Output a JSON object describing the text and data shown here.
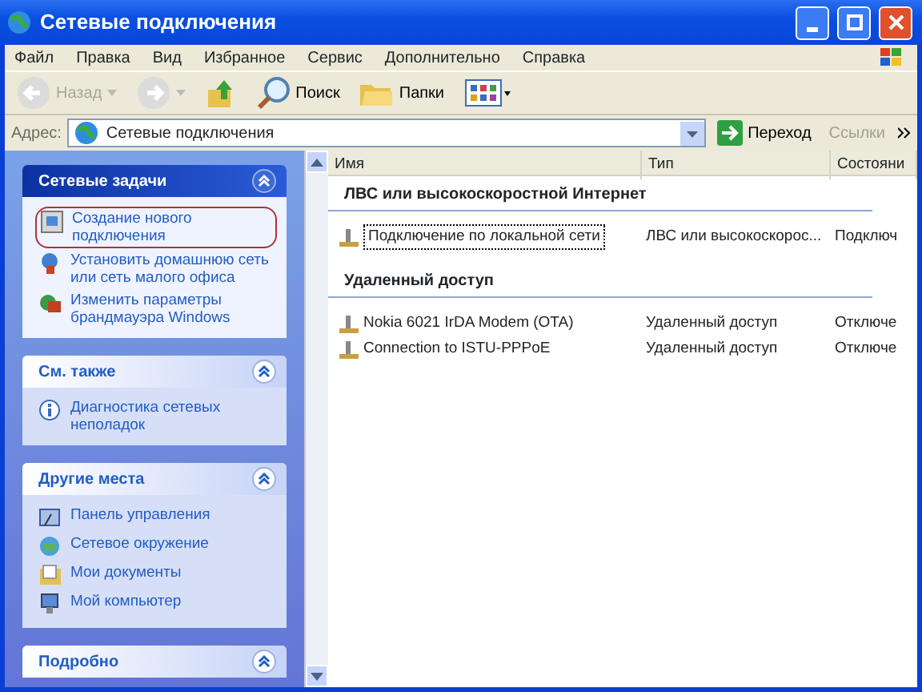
{
  "window": {
    "title": "Сетевые подключения"
  },
  "menu": [
    "Файл",
    "Правка",
    "Вид",
    "Избранное",
    "Сервис",
    "Дополнительно",
    "Справка"
  ],
  "toolbar": [
    {
      "kind": "back",
      "label": "Назад",
      "disabled": true
    },
    {
      "kind": "forward",
      "disabled": true
    },
    {
      "kind": "up",
      "disabled": false
    },
    {
      "kind": "search",
      "label": "Поиск",
      "disabled": false
    },
    {
      "kind": "folders",
      "label": "Папки",
      "disabled": false
    },
    {
      "kind": "views",
      "disabled": false
    }
  ],
  "address_bar": {
    "label": "Адрес:",
    "value": "Сетевые подключения",
    "go_button": "Переход",
    "links": "Ссылки"
  },
  "sidebar": {
    "panels": [
      {
        "title": "Сетевые задачи",
        "items": [
          {
            "kind": "wizard",
            "label": "Создание нового подключения",
            "highlighted": true
          },
          {
            "kind": "home",
            "label": "Установить домашнюю сеть или сеть малого офиса",
            "highlighted": false
          },
          {
            "kind": "firewall",
            "label": "Изменить параметры брандмауэра Windows",
            "highlighted": false
          }
        ]
      },
      {
        "title": "См. также",
        "items": [
          {
            "kind": "info",
            "label": "Диагностика сетевых неполадок",
            "highlighted": false
          }
        ]
      },
      {
        "title": "Другие места",
        "items": [
          {
            "kind": "control",
            "label": "Панель управления",
            "highlighted": false
          },
          {
            "kind": "network",
            "label": "Сетевое окружение",
            "highlighted": false
          },
          {
            "kind": "documents",
            "label": "Мои документы",
            "highlighted": false
          },
          {
            "kind": "computer",
            "label": "Мой компьютер",
            "highlighted": false
          }
        ]
      },
      {
        "title": "Подробно"
      }
    ]
  },
  "table": {
    "columns": [
      "Имя",
      "Тип",
      "Состояни"
    ],
    "groups": [
      {
        "title": "ЛВС или высокоскоростной Интернет",
        "rows": [
          {
            "name": "Подключение по локальной сети",
            "type": "ЛВС или высокоскорос...",
            "status": "Подключ",
            "selected": true
          }
        ]
      },
      {
        "title": "Удаленный доступ",
        "rows": [
          {
            "name": "Nokia 6021 IrDA Modem (OTA)",
            "type": "Удаленный доступ",
            "status": "Отключе",
            "selected": false
          },
          {
            "name": "Connection to ISTU-PPPoE",
            "type": "Удаленный доступ",
            "status": "Отключе",
            "selected": false
          }
        ]
      }
    ]
  }
}
